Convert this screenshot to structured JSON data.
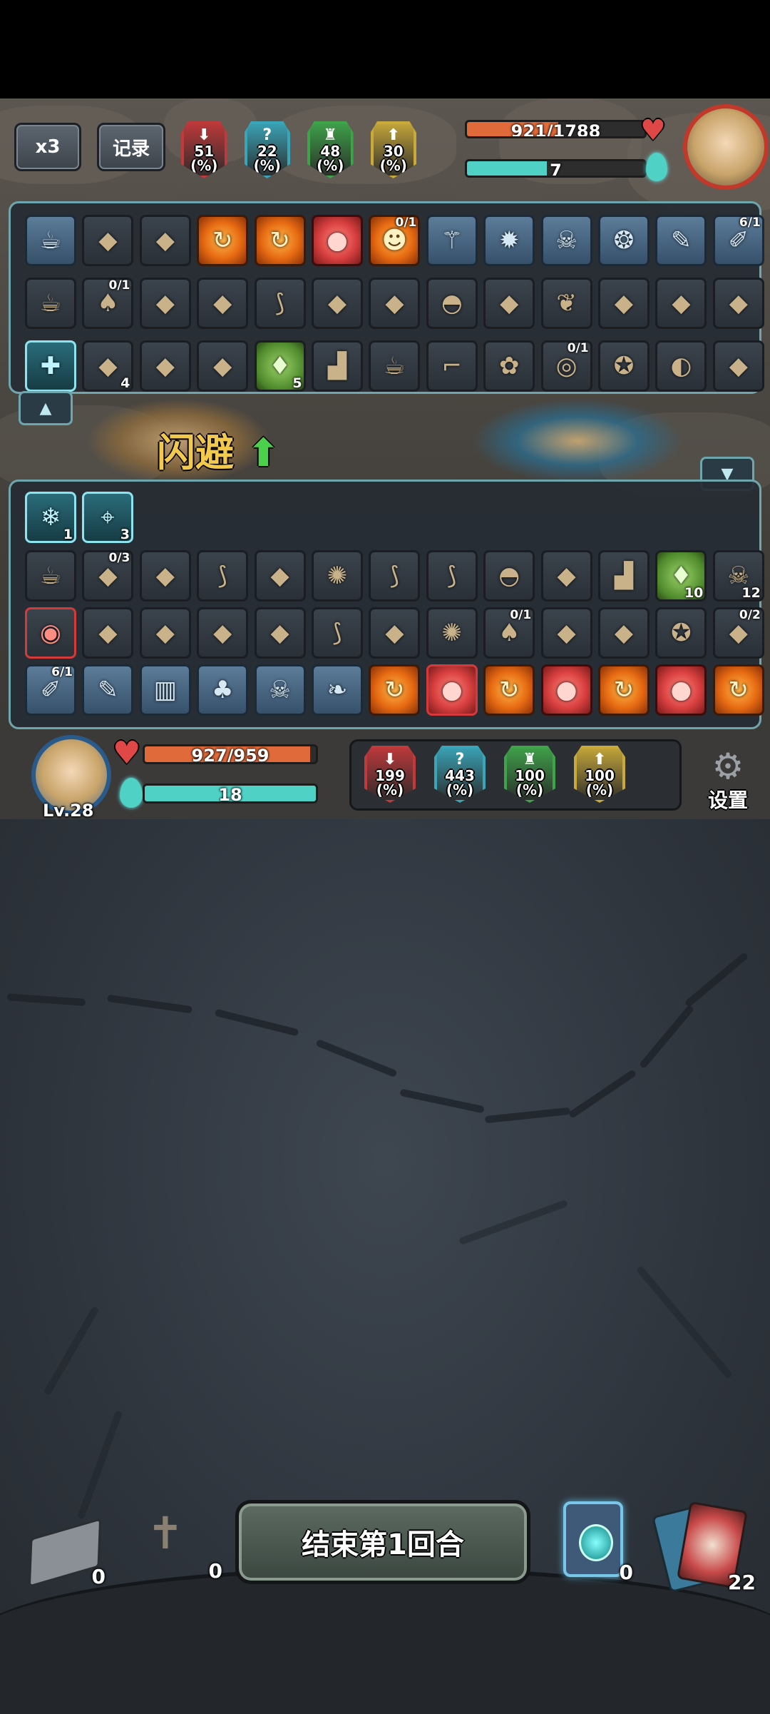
{
  "top": {
    "speed_label": "x3",
    "record_label": "记录",
    "enemy_stats": [
      {
        "icon": "sword-down-icon",
        "value": "51",
        "unit": "(%)",
        "color": "#c0393b"
      },
      {
        "icon": "question-icon",
        "value": "22",
        "unit": "(%)",
        "color": "#3aa5b8"
      },
      {
        "icon": "castle-icon",
        "value": "48",
        "unit": "(%)",
        "color": "#3fa34a"
      },
      {
        "icon": "arrow-up-icon",
        "value": "30",
        "unit": "(%)",
        "color": "#c8a93a"
      }
    ],
    "enemy_hp": "921/1788",
    "enemy_hp_fraction": 0.515,
    "enemy_mana": "7",
    "enemy_mana_fraction": 0.45
  },
  "enemy_items": {
    "rows": [
      [
        {
          "icon": "fire-teacup-icon",
          "style": "blue"
        },
        {
          "icon": "gourd-icon",
          "style": "plain"
        },
        {
          "icon": "backpack-icon",
          "style": "plain"
        },
        {
          "icon": "swirl-icon",
          "style": "orange"
        },
        {
          "icon": "swirl-icon",
          "style": "orange"
        },
        {
          "icon": "flesh-chunk-icon",
          "style": "red"
        },
        {
          "icon": "orange-blob-icon",
          "style": "orange",
          "frac": "0/1"
        },
        {
          "icon": "winged-staff-icon",
          "style": "blue"
        },
        {
          "icon": "gear-rune-icon",
          "style": "blue"
        },
        {
          "icon": "skull-rune-icon",
          "style": "blue"
        },
        {
          "icon": "beetle-rune-icon",
          "style": "blue"
        },
        {
          "icon": "wrench-rune-icon",
          "style": "blue"
        },
        {
          "icon": "drill-rune-icon",
          "style": "blue",
          "frac": "6/1"
        }
      ],
      [
        {
          "icon": "teacup-icon",
          "style": "plain"
        },
        {
          "icon": "mushroom-icon",
          "style": "plain",
          "frac": "0/1"
        },
        {
          "icon": "sack-icon",
          "style": "plain"
        },
        {
          "icon": "goggles-icon",
          "style": "plain"
        },
        {
          "icon": "horn-icon",
          "style": "plain"
        },
        {
          "icon": "golden-glove-icon",
          "style": "plain"
        },
        {
          "icon": "pouch-icon",
          "style": "plain"
        },
        {
          "icon": "helmet-icon",
          "style": "plain"
        },
        {
          "icon": "stick-icon",
          "style": "plain"
        },
        {
          "icon": "feather-icon",
          "style": "plain"
        },
        {
          "icon": "branch-icon",
          "style": "plain"
        },
        {
          "icon": "fish-icon",
          "style": "plain"
        },
        {
          "icon": "armor-icon",
          "style": "plain"
        }
      ],
      [
        {
          "icon": "figure-plus-icon",
          "style": "cyan"
        },
        {
          "icon": "green-slash-icon",
          "style": "plain",
          "count": "4"
        },
        {
          "icon": "cyan-splash-icon",
          "style": "plain"
        },
        {
          "icon": "cyan-portal-icon",
          "style": "plain"
        },
        {
          "icon": "green-bag-icon",
          "style": "green",
          "count": "5"
        },
        {
          "icon": "boot-icon",
          "style": "plain"
        },
        {
          "icon": "teacup-icon",
          "style": "plain"
        },
        {
          "icon": "pistol-icon",
          "style": "plain"
        },
        {
          "icon": "flower-icon",
          "style": "plain"
        },
        {
          "icon": "galaxy-icon",
          "style": "plain",
          "frac": "0/1"
        },
        {
          "icon": "green-rune-icon",
          "style": "plain"
        },
        {
          "icon": "pan-icon",
          "style": "plain"
        },
        {
          "icon": "crystal-icon",
          "style": "plain"
        }
      ]
    ]
  },
  "scene": {
    "dodge_label": "闪避"
  },
  "player_items": {
    "effects": [
      {
        "icon": "snowflake-icon",
        "count": "1"
      },
      {
        "icon": "crosshair-icon",
        "count": "3"
      }
    ],
    "rows": [
      [
        {
          "icon": "teacup-icon",
          "style": "plain"
        },
        {
          "icon": "red-egg-icon",
          "style": "plain",
          "frac": "0/3"
        },
        {
          "icon": "spellbook-icon",
          "style": "plain"
        },
        {
          "icon": "horn-icon",
          "style": "plain"
        },
        {
          "icon": "broom-icon",
          "style": "plain"
        },
        {
          "icon": "fire-orb-icon",
          "style": "plain"
        },
        {
          "icon": "scroll-icon",
          "style": "plain"
        },
        {
          "icon": "scroll-icon",
          "style": "plain"
        },
        {
          "icon": "green-helmet-icon",
          "style": "plain"
        },
        {
          "icon": "stick-bundle-icon",
          "style": "plain"
        },
        {
          "icon": "boot-icon",
          "style": "plain"
        },
        {
          "icon": "green-bag-icon",
          "style": "green",
          "count": "10"
        },
        {
          "icon": "skull-crossbones-icon",
          "style": "plain",
          "count": "12"
        }
      ],
      [
        {
          "icon": "red-ring-icon",
          "style": "red-border"
        },
        {
          "icon": "hamster-icon",
          "style": "plain"
        },
        {
          "icon": "meat-icon",
          "style": "plain"
        },
        {
          "icon": "mask-icon",
          "style": "plain"
        },
        {
          "icon": "red-glove-icon",
          "style": "plain"
        },
        {
          "icon": "blue-horn-icon",
          "style": "plain"
        },
        {
          "icon": "potion-icon",
          "style": "plain"
        },
        {
          "icon": "fire-apple-icon",
          "style": "plain"
        },
        {
          "icon": "mushroom-icon",
          "style": "plain",
          "frac": "0/1"
        },
        {
          "icon": "claw-icon",
          "style": "plain"
        },
        {
          "icon": "sack-icon",
          "style": "plain"
        },
        {
          "icon": "green-rune-icon",
          "style": "plain"
        },
        {
          "icon": "gauntlet-icon",
          "style": "plain",
          "frac": "0/2"
        }
      ],
      [
        {
          "icon": "drill-rune-icon",
          "style": "blue",
          "frac": "6/1"
        },
        {
          "icon": "wrench-rune-icon",
          "style": "blue"
        },
        {
          "icon": "piano-icon",
          "style": "blue"
        },
        {
          "icon": "tree-rune-icon",
          "style": "blue"
        },
        {
          "icon": "skull-rune-icon",
          "style": "blue"
        },
        {
          "icon": "bird-rune-icon",
          "style": "blue"
        },
        {
          "icon": "swirl-icon",
          "style": "orange"
        },
        {
          "icon": "flesh-chunk-icon",
          "style": "red",
          "selected": true
        },
        {
          "icon": "swirl-icon",
          "style": "orange"
        },
        {
          "icon": "flesh-chunk-icon",
          "style": "red"
        },
        {
          "icon": "swirl-icon",
          "style": "orange"
        },
        {
          "icon": "flesh-chunk-icon",
          "style": "red"
        },
        {
          "icon": "swirl-icon",
          "style": "orange"
        }
      ]
    ]
  },
  "player": {
    "level": "Lv.28",
    "hp": "927/959",
    "hp_fraction": 0.967,
    "mana": "18",
    "mana_fraction": 1.0,
    "stats": [
      {
        "icon": "sword-down-icon",
        "value": "199",
        "unit": "(%)",
        "color": "#c0393b"
      },
      {
        "icon": "question-icon",
        "value": "443",
        "unit": "(%)",
        "color": "#3aa5b8"
      },
      {
        "icon": "castle-icon",
        "value": "100",
        "unit": "(%)",
        "color": "#3fa34a"
      },
      {
        "icon": "arrow-up-icon",
        "value": "100",
        "unit": "(%)",
        "color": "#c8a93a"
      }
    ],
    "settings_label": "设置"
  },
  "bottom": {
    "draw_count": "0",
    "grave_count": "0",
    "end_turn_label": "结束第1回合",
    "potion_count": "0",
    "deck_count": "22"
  },
  "colors": {
    "hp": "#e06a3a",
    "mana": "#4fd1c5",
    "panel_border": "#6fa6ad"
  }
}
